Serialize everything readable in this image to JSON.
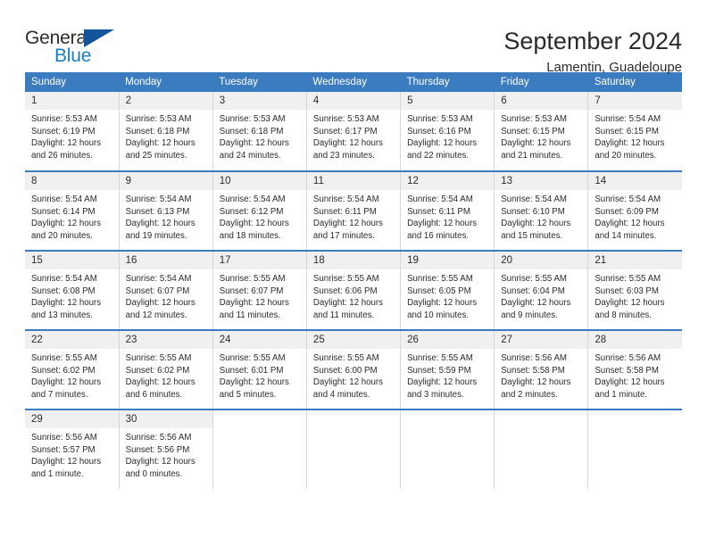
{
  "logo": {
    "word_top": "General",
    "word_bottom": "Blue",
    "triangle_color": "#13559b",
    "blue_color": "#1a7fc1"
  },
  "header": {
    "title": "September 2024",
    "location": "Lamentin, Guadeloupe"
  },
  "theme": {
    "header_blue": "#3b7cc0",
    "daynum_band": "#f0f0f0",
    "cell_border": "#d6d6d6"
  },
  "weekdays": [
    "Sunday",
    "Monday",
    "Tuesday",
    "Wednesday",
    "Thursday",
    "Friday",
    "Saturday"
  ],
  "days": [
    {
      "date": "1",
      "sunrise": "Sunrise: 5:53 AM",
      "sunset": "Sunset: 6:19 PM",
      "daylight1": "Daylight: 12 hours",
      "daylight2": "and 26 minutes."
    },
    {
      "date": "2",
      "sunrise": "Sunrise: 5:53 AM",
      "sunset": "Sunset: 6:18 PM",
      "daylight1": "Daylight: 12 hours",
      "daylight2": "and 25 minutes."
    },
    {
      "date": "3",
      "sunrise": "Sunrise: 5:53 AM",
      "sunset": "Sunset: 6:18 PM",
      "daylight1": "Daylight: 12 hours",
      "daylight2": "and 24 minutes."
    },
    {
      "date": "4",
      "sunrise": "Sunrise: 5:53 AM",
      "sunset": "Sunset: 6:17 PM",
      "daylight1": "Daylight: 12 hours",
      "daylight2": "and 23 minutes."
    },
    {
      "date": "5",
      "sunrise": "Sunrise: 5:53 AM",
      "sunset": "Sunset: 6:16 PM",
      "daylight1": "Daylight: 12 hours",
      "daylight2": "and 22 minutes."
    },
    {
      "date": "6",
      "sunrise": "Sunrise: 5:53 AM",
      "sunset": "Sunset: 6:15 PM",
      "daylight1": "Daylight: 12 hours",
      "daylight2": "and 21 minutes."
    },
    {
      "date": "7",
      "sunrise": "Sunrise: 5:54 AM",
      "sunset": "Sunset: 6:15 PM",
      "daylight1": "Daylight: 12 hours",
      "daylight2": "and 20 minutes."
    },
    {
      "date": "8",
      "sunrise": "Sunrise: 5:54 AM",
      "sunset": "Sunset: 6:14 PM",
      "daylight1": "Daylight: 12 hours",
      "daylight2": "and 20 minutes."
    },
    {
      "date": "9",
      "sunrise": "Sunrise: 5:54 AM",
      "sunset": "Sunset: 6:13 PM",
      "daylight1": "Daylight: 12 hours",
      "daylight2": "and 19 minutes."
    },
    {
      "date": "10",
      "sunrise": "Sunrise: 5:54 AM",
      "sunset": "Sunset: 6:12 PM",
      "daylight1": "Daylight: 12 hours",
      "daylight2": "and 18 minutes."
    },
    {
      "date": "11",
      "sunrise": "Sunrise: 5:54 AM",
      "sunset": "Sunset: 6:11 PM",
      "daylight1": "Daylight: 12 hours",
      "daylight2": "and 17 minutes."
    },
    {
      "date": "12",
      "sunrise": "Sunrise: 5:54 AM",
      "sunset": "Sunset: 6:11 PM",
      "daylight1": "Daylight: 12 hours",
      "daylight2": "and 16 minutes."
    },
    {
      "date": "13",
      "sunrise": "Sunrise: 5:54 AM",
      "sunset": "Sunset: 6:10 PM",
      "daylight1": "Daylight: 12 hours",
      "daylight2": "and 15 minutes."
    },
    {
      "date": "14",
      "sunrise": "Sunrise: 5:54 AM",
      "sunset": "Sunset: 6:09 PM",
      "daylight1": "Daylight: 12 hours",
      "daylight2": "and 14 minutes."
    },
    {
      "date": "15",
      "sunrise": "Sunrise: 5:54 AM",
      "sunset": "Sunset: 6:08 PM",
      "daylight1": "Daylight: 12 hours",
      "daylight2": "and 13 minutes."
    },
    {
      "date": "16",
      "sunrise": "Sunrise: 5:54 AM",
      "sunset": "Sunset: 6:07 PM",
      "daylight1": "Daylight: 12 hours",
      "daylight2": "and 12 minutes."
    },
    {
      "date": "17",
      "sunrise": "Sunrise: 5:55 AM",
      "sunset": "Sunset: 6:07 PM",
      "daylight1": "Daylight: 12 hours",
      "daylight2": "and 11 minutes."
    },
    {
      "date": "18",
      "sunrise": "Sunrise: 5:55 AM",
      "sunset": "Sunset: 6:06 PM",
      "daylight1": "Daylight: 12 hours",
      "daylight2": "and 11 minutes."
    },
    {
      "date": "19",
      "sunrise": "Sunrise: 5:55 AM",
      "sunset": "Sunset: 6:05 PM",
      "daylight1": "Daylight: 12 hours",
      "daylight2": "and 10 minutes."
    },
    {
      "date": "20",
      "sunrise": "Sunrise: 5:55 AM",
      "sunset": "Sunset: 6:04 PM",
      "daylight1": "Daylight: 12 hours",
      "daylight2": "and 9 minutes."
    },
    {
      "date": "21",
      "sunrise": "Sunrise: 5:55 AM",
      "sunset": "Sunset: 6:03 PM",
      "daylight1": "Daylight: 12 hours",
      "daylight2": "and 8 minutes."
    },
    {
      "date": "22",
      "sunrise": "Sunrise: 5:55 AM",
      "sunset": "Sunset: 6:02 PM",
      "daylight1": "Daylight: 12 hours",
      "daylight2": "and 7 minutes."
    },
    {
      "date": "23",
      "sunrise": "Sunrise: 5:55 AM",
      "sunset": "Sunset: 6:02 PM",
      "daylight1": "Daylight: 12 hours",
      "daylight2": "and 6 minutes."
    },
    {
      "date": "24",
      "sunrise": "Sunrise: 5:55 AM",
      "sunset": "Sunset: 6:01 PM",
      "daylight1": "Daylight: 12 hours",
      "daylight2": "and 5 minutes."
    },
    {
      "date": "25",
      "sunrise": "Sunrise: 5:55 AM",
      "sunset": "Sunset: 6:00 PM",
      "daylight1": "Daylight: 12 hours",
      "daylight2": "and 4 minutes."
    },
    {
      "date": "26",
      "sunrise": "Sunrise: 5:55 AM",
      "sunset": "Sunset: 5:59 PM",
      "daylight1": "Daylight: 12 hours",
      "daylight2": "and 3 minutes."
    },
    {
      "date": "27",
      "sunrise": "Sunrise: 5:56 AM",
      "sunset": "Sunset: 5:58 PM",
      "daylight1": "Daylight: 12 hours",
      "daylight2": "and 2 minutes."
    },
    {
      "date": "28",
      "sunrise": "Sunrise: 5:56 AM",
      "sunset": "Sunset: 5:58 PM",
      "daylight1": "Daylight: 12 hours",
      "daylight2": "and 1 minute."
    },
    {
      "date": "29",
      "sunrise": "Sunrise: 5:56 AM",
      "sunset": "Sunset: 5:57 PM",
      "daylight1": "Daylight: 12 hours",
      "daylight2": "and 1 minute."
    },
    {
      "date": "30",
      "sunrise": "Sunrise: 5:56 AM",
      "sunset": "Sunset: 5:56 PM",
      "daylight1": "Daylight: 12 hours",
      "daylight2": "and 0 minutes."
    }
  ]
}
